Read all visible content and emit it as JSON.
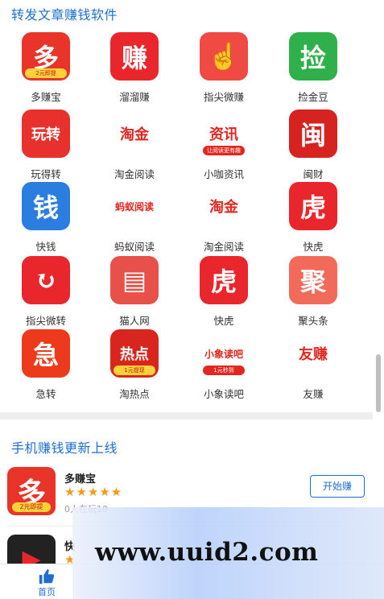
{
  "section1": {
    "title": "转发文章赚钱软件",
    "apps": [
      {
        "label": "多赚宝",
        "icon": "duozhuanbao-icon",
        "glyph": "多",
        "badge": "2元即提",
        "bg": "#e9342a"
      },
      {
        "label": "溜溜赚",
        "icon": "liuliuzhuan-icon",
        "glyph": "赚",
        "badge": "",
        "bg": "#e8262b"
      },
      {
        "label": "指尖微赚",
        "icon": "zhijianweizhuan-icon",
        "glyph": "☝",
        "badge": "",
        "bg": "#f04a44"
      },
      {
        "label": "捡金豆",
        "icon": "jianjindou-icon",
        "glyph": "捡",
        "badge": "",
        "bg": "#2fb04a"
      },
      {
        "label": "玩得转",
        "icon": "wandezhuan-icon",
        "glyph": "玩转",
        "badge": "",
        "bg": "#e8302c"
      },
      {
        "label": "淘金阅读",
        "icon": "taojinyuedu-icon",
        "glyph": "淘金",
        "badge": "",
        "bg": "#ffffff"
      },
      {
        "label": "小咖资讯",
        "icon": "xiaokazixun-icon",
        "glyph": "资讯",
        "badge": "让阅读更有趣",
        "bg": "#ffffff"
      },
      {
        "label": "闽财",
        "icon": "mincai-icon",
        "glyph": "闽",
        "badge": "",
        "bg": "#d6231f"
      },
      {
        "label": "快钱",
        "icon": "kuaiqian-icon",
        "glyph": "钱",
        "badge": "",
        "bg": "#2b7de0"
      },
      {
        "label": "蚂蚁阅读",
        "icon": "mayiyuedu-icon",
        "glyph": "蚂蚁阅读",
        "badge": "",
        "bg": "#ffffff"
      },
      {
        "label": "淘金阅读",
        "icon": "taojinyuedu-icon",
        "glyph": "淘金",
        "badge": "",
        "bg": "#ffffff"
      },
      {
        "label": "快虎",
        "icon": "kuaihu-icon",
        "glyph": "虎",
        "badge": "",
        "bg": "#e8262b"
      },
      {
        "label": "指尖微转",
        "icon": "zhijianweizhuan2-icon",
        "glyph": "↻",
        "badge": "",
        "bg": "#e8262b"
      },
      {
        "label": "猫人网",
        "icon": "maorenwang-icon",
        "glyph": "▤",
        "badge": "",
        "bg": "#e8504a"
      },
      {
        "label": "快虎",
        "icon": "kuaihu-icon",
        "glyph": "虎",
        "badge": "",
        "bg": "#e8262b"
      },
      {
        "label": "聚头条",
        "icon": "jutoutiao-icon",
        "glyph": "聚",
        "badge": "",
        "bg": "#f26a5a"
      },
      {
        "label": "急转",
        "icon": "jizhuan-icon",
        "glyph": "急",
        "badge": "",
        "bg": "#ee3a1c"
      },
      {
        "label": "淘热点",
        "icon": "taoredian-icon",
        "glyph": "热点",
        "badge": "1元提现",
        "bg": "#d8251d"
      },
      {
        "label": "小象读吧",
        "icon": "xiaoxiangduba-icon",
        "glyph": "小象读吧",
        "badge": "1元秒到",
        "bg": "#ffffff"
      },
      {
        "label": "友赚",
        "icon": "youzhuan-icon",
        "glyph": "友赚",
        "badge": "",
        "bg": "#ffffff"
      }
    ]
  },
  "section2": {
    "title": "手机赚钱更新上线",
    "items": [
      {
        "name": "多赚宝",
        "icon": "duozhuanbao-icon",
        "glyph": "多",
        "badge": "2元即提",
        "stars": "★★★★★",
        "sub": "0人在玩10",
        "button": "开始赚"
      },
      {
        "name": "快",
        "icon": "video-app-icon",
        "glyph": "▶",
        "badge": "",
        "stars": "★",
        "sub": "",
        "button": ""
      }
    ]
  },
  "nav": {
    "home_label": "首页",
    "home_icon": "thumbs-up-icon"
  },
  "watermark": "www.uuid2.com",
  "colors": {
    "accent": "#1e6fd1",
    "star": "#f39a1c",
    "brand_red": "#e8262b"
  }
}
